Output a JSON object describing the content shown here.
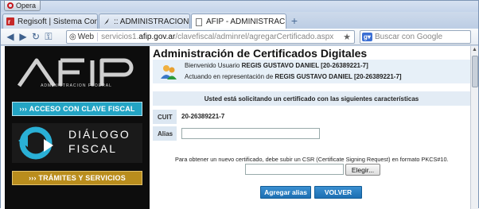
{
  "browser": {
    "name": "Opera",
    "tabs": [
      {
        "label": "Regisoft | Sistema Cont..."
      },
      {
        "label": ":: ADMINISTRACION FE..."
      },
      {
        "label": "AFIP - ADMINISTRACI..."
      }
    ],
    "address": {
      "prefix": "Web",
      "host_pre": "servicios1.",
      "host_main": "afip.gov.ar",
      "path": "/clavefiscal/adminrel/agregarCertificado.aspx"
    },
    "search_placeholder": "Buscar con Google"
  },
  "sidebar": {
    "logo_text": "AFIP",
    "logo_subtitle": "ADMINISTRACION FEDERAL",
    "btn_clave": "ACCESO CON CLAVE FISCAL",
    "dialogo_1": "DIÁLOGO",
    "dialogo_2": "FISCAL",
    "btn_tramites": "TRÁMITES Y SERVICIOS"
  },
  "main": {
    "title": "Administración de Certificados Digitales",
    "welcome_prefix": "Bienvenido Usuario ",
    "welcome_user": "REGIS GUSTAVO DANIEL [20-26389221-7]",
    "acting_prefix": "Actuando en representación de ",
    "acting_user": "REGIS GUSTAVO DANIEL [20-26389221-7]",
    "request_text": "Usted está solicitando un certificado con las siguientes características",
    "cuit_label": "CUIT",
    "cuit_value": "20-26389221-7",
    "alias_label": "Alias",
    "alias_value": "",
    "csr_note": "Para obtener un nuevo certificado, debe subir un CSR (Certificate Signing Request) en formato PKCS#10.",
    "choose_button": "Elegir...",
    "add_alias_button": "Agregar alias",
    "back_button": "VOLVER"
  },
  "colors": {
    "sidebar_bg": "#0d0d0d",
    "cyan_btn": "#23a4c4",
    "amber_btn": "#b98d1d",
    "blue_btn": "#1d6fb3"
  }
}
